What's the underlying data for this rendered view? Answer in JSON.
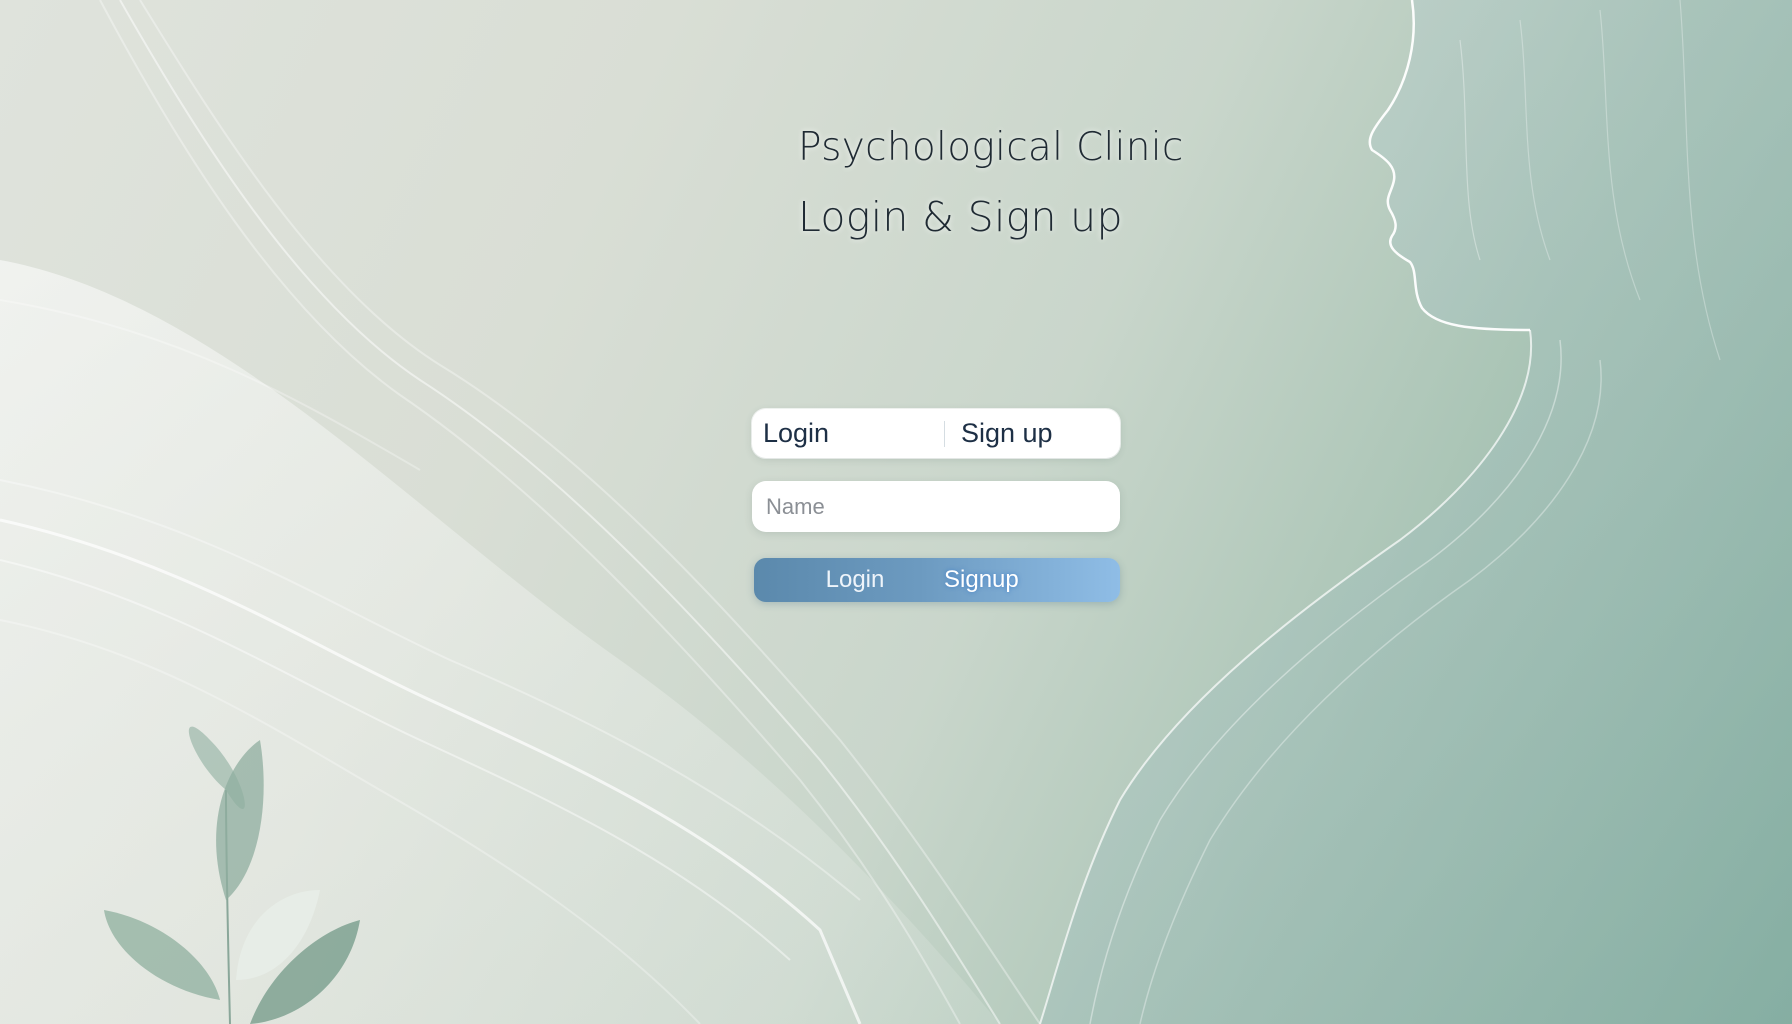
{
  "header": {
    "title": "Psychological Clinic",
    "subtitle": "Login & Sign up"
  },
  "tabs": {
    "login_label": "Login",
    "signup_label": "Sign up"
  },
  "name_field": {
    "placeholder": "Name"
  },
  "actions": {
    "login_label": "Login",
    "signup_label": "Signup"
  },
  "colors": {
    "background_light": "#dfe3dc",
    "background_sage": "#8fb6a6",
    "button_start": "#5b89ac",
    "button_end": "#8fbde6",
    "text_dark": "#1f2a33"
  },
  "decor": {
    "silhouette": "face-profile-silhouette",
    "leaves": "leaf-sprig-icon",
    "waves": "flowing-line-waves"
  }
}
